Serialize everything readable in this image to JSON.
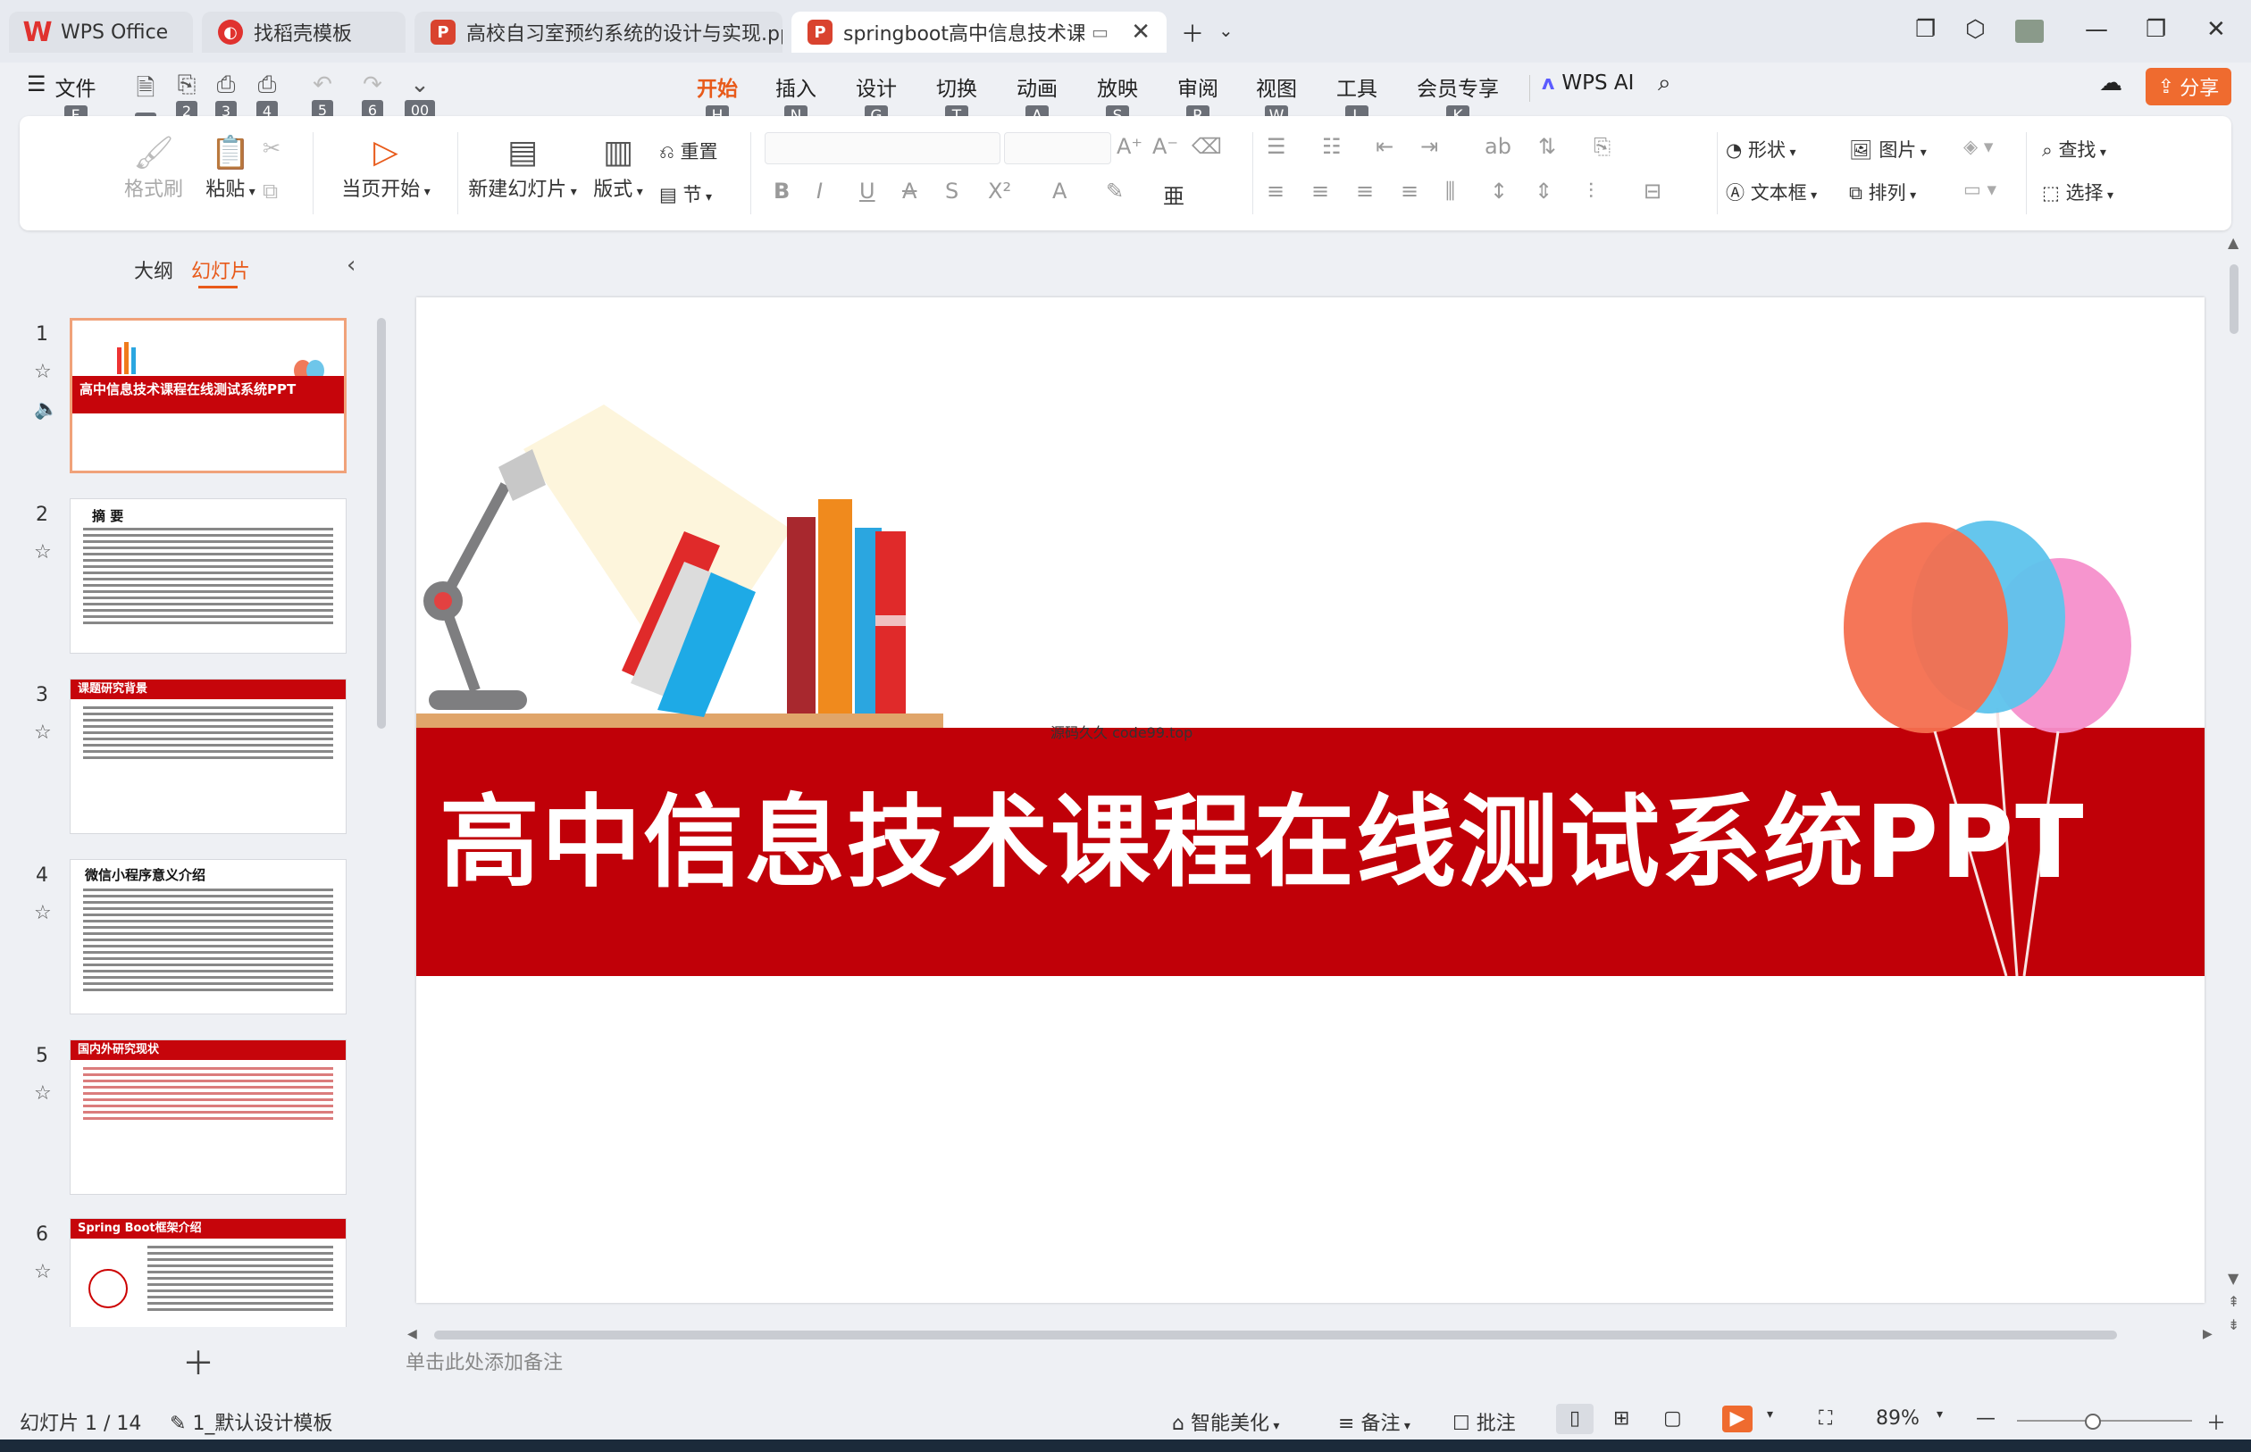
{
  "tabs": [
    {
      "label": "WPS Office"
    },
    {
      "label": "找稻壳模板"
    },
    {
      "label": "高校自习室预约系统的设计与实现.ppt"
    },
    {
      "label": "springboot高中信息技术课程"
    }
  ],
  "menu": {
    "file": "文件",
    "file_key": "F",
    "items": [
      {
        "label": "开始",
        "key": "H"
      },
      {
        "label": "插入",
        "key": "N"
      },
      {
        "label": "设计",
        "key": "G"
      },
      {
        "label": "切换",
        "key": "T"
      },
      {
        "label": "动画",
        "key": "A"
      },
      {
        "label": "放映",
        "key": "S"
      },
      {
        "label": "审阅",
        "key": "R"
      },
      {
        "label": "视图",
        "key": "W"
      },
      {
        "label": "工具",
        "key": "L"
      },
      {
        "label": "会员专享",
        "key": "K"
      }
    ],
    "qa_keys": [
      "1",
      "2",
      "3",
      "4",
      "5",
      "6",
      "00"
    ],
    "wps_ai": "WPS AI",
    "share": "分享"
  },
  "ribbon": {
    "format_painter": "格式刷",
    "paste": "粘贴",
    "start_from_current": "当页开始",
    "new_slide": "新建幻灯片",
    "layout": "版式",
    "reset": "重置",
    "section": "节",
    "shape": "形状",
    "picture": "图片",
    "textbox": "文本框",
    "arrange": "排列",
    "find": "查找",
    "select": "选择"
  },
  "left_panel": {
    "tab_outline": "大纲",
    "tab_slides": "幻灯片",
    "slides": [
      {
        "num": "1",
        "title": "高中信息技术课程在线测试系统PPT"
      },
      {
        "num": "2",
        "title": "摘  要"
      },
      {
        "num": "3",
        "title": "课题研究背景"
      },
      {
        "num": "4",
        "title": "微信小程序意义介绍"
      },
      {
        "num": "5",
        "title": "国内外研究现状"
      },
      {
        "num": "6",
        "title": "Spring Boot框架介绍"
      }
    ]
  },
  "slide": {
    "title": "高中信息技术课程在线测试系统PPT",
    "watermark": "源码久久 code99.top"
  },
  "notes_placeholder": "单击此处添加备注",
  "status": {
    "slide_counter": "幻灯片 1 / 14",
    "template": "1_默认设计模板",
    "beautify": "智能美化",
    "notes": "备注",
    "comment": "批注",
    "zoom": "89%"
  }
}
